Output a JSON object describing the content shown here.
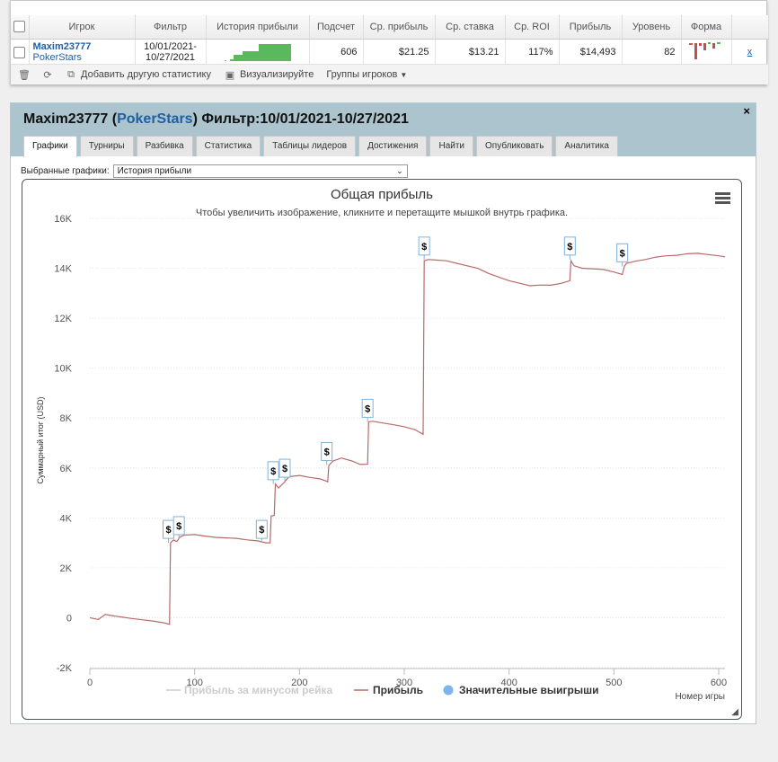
{
  "table": {
    "headers": [
      "Игрок",
      "Фильтр",
      "История прибыли",
      "Подсчет",
      "Ср. прибыль",
      "Ср. ставка",
      "Ср. ROI",
      "Прибыль",
      "Уровень",
      "Форма"
    ],
    "row": {
      "player": "Maxim23777",
      "site": "PokerStars",
      "filter_from": "10/01/2021-",
      "filter_to": "10/27/2021",
      "count": "606",
      "avg_profit": "$21.25",
      "avg_stake": "$13.21",
      "avg_roi": "117%",
      "profit": "$14,493",
      "level": "82",
      "remove": "x"
    }
  },
  "toolbar": {
    "add_stat": "Добавить другую статистику",
    "visualize": "Визуализируйте",
    "groups": "Группы игроков"
  },
  "panel": {
    "player": "Maxim23777",
    "open_paren": "(",
    "site": "PokerStars",
    "close_paren": ")",
    "filter": "Фильтр:10/01/2021-10/27/2021",
    "close": "×",
    "tabs": [
      "Графики",
      "Турниры",
      "Разбивка",
      "Статистика",
      "Таблицы лидеров",
      "Достижения",
      "Найти",
      "Опубликовать",
      "Аналитика"
    ],
    "selected_label": "Выбранные графики:",
    "selected_value": "История прибыли"
  },
  "chart_data": {
    "type": "line",
    "title": "Общая прибыль",
    "subtitle": "Чтобы увеличить изображение, кликните и перетащите мышкой внутрь графика.",
    "xlabel": "Номер игры",
    "ylabel": "Суммарный итог (USD)",
    "xlim": [
      0,
      606
    ],
    "ylim": [
      -2000,
      16000
    ],
    "xticks": [
      "0",
      "100",
      "200",
      "300",
      "400",
      "500",
      "600"
    ],
    "yticks": [
      "-2K",
      "0",
      "2K",
      "4K",
      "6K",
      "8K",
      "10K",
      "12K",
      "14K",
      "16K"
    ],
    "grid": true,
    "legend_position": "bottom-center",
    "series": [
      {
        "name": "Прибыль за минусом рейка",
        "color": "#cccccc",
        "hidden": true,
        "x": [],
        "y": []
      },
      {
        "name": "Прибыль",
        "color": "#b86a6a",
        "x": [
          0,
          8,
          12,
          15,
          20,
          30,
          40,
          50,
          60,
          70,
          76,
          77,
          80,
          83,
          86,
          90,
          100,
          110,
          120,
          130,
          140,
          150,
          160,
          168,
          172,
          173,
          176,
          177,
          180,
          185,
          186,
          190,
          200,
          210,
          220,
          227,
          228,
          232,
          240,
          250,
          258,
          265,
          266,
          270,
          280,
          290,
          300,
          310,
          318,
          319,
          323,
          330,
          340,
          350,
          360,
          370,
          380,
          390,
          400,
          410,
          420,
          430,
          440,
          450,
          458,
          459,
          462,
          470,
          480,
          490,
          500,
          508,
          510,
          512,
          520,
          530,
          540,
          550,
          560,
          570,
          580,
          590,
          600,
          606
        ],
        "y": [
          0,
          -70,
          50,
          130,
          90,
          30,
          -30,
          -80,
          -130,
          -200,
          -260,
          3000,
          3120,
          3050,
          3230,
          3310,
          3330,
          3270,
          3220,
          3200,
          3180,
          3120,
          3080,
          3000,
          3000,
          4080,
          4100,
          5360,
          5200,
          5400,
          5450,
          5650,
          5700,
          5620,
          5560,
          5450,
          6100,
          6280,
          6400,
          6280,
          6140,
          6150,
          7850,
          7870,
          7800,
          7730,
          7650,
          7540,
          7350,
          14300,
          14350,
          14330,
          14300,
          14200,
          14100,
          14000,
          13800,
          13650,
          13500,
          13400,
          13300,
          13330,
          13320,
          13400,
          13500,
          14300,
          14100,
          14000,
          13980,
          13950,
          13850,
          13750,
          14080,
          14200,
          14280,
          14350,
          14450,
          14500,
          14520,
          14580,
          14600,
          14550,
          14500,
          14460
        ]
      }
    ],
    "big_wins_label": "Значительные выигрыши",
    "big_win_marker_symbol": "$",
    "big_wins": [
      {
        "x": 75,
        "y": 3000
      },
      {
        "x": 85,
        "y": 3150
      },
      {
        "x": 164,
        "y": 3000
      },
      {
        "x": 175,
        "y": 5350
      },
      {
        "x": 186,
        "y": 5450
      },
      {
        "x": 226,
        "y": 6120
      },
      {
        "x": 265,
        "y": 7850
      },
      {
        "x": 319,
        "y": 14350
      },
      {
        "x": 458,
        "y": 14350
      },
      {
        "x": 508,
        "y": 14080
      }
    ]
  }
}
